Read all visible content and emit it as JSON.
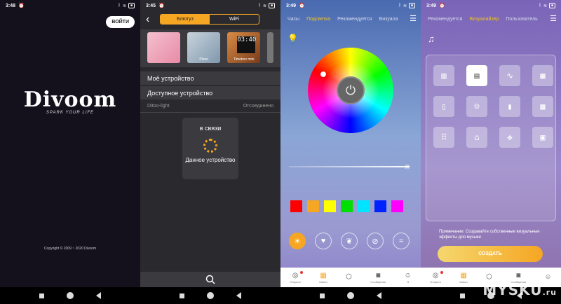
{
  "screen1": {
    "status_time": "3:48",
    "login_label": "ВОЙТИ",
    "logo_text": "Divoom",
    "logo_tagline": "SPARK YOUR LIFE",
    "copyright": "Copyright © 2009 ~ 2020 Divoom"
  },
  "screen2": {
    "status_time": "3:45",
    "tab_bluetooth": "Блютуз",
    "tab_wifi": "WiFi",
    "thumbs": [
      {
        "caption": ""
      },
      {
        "caption": "Pixoo"
      },
      {
        "caption": "Timebox mini"
      }
    ],
    "clock_text": "03:40",
    "my_device": "Моё устройство",
    "available_device": "Доступное устройство",
    "device_name": "Ditoo-light",
    "device_status": "Отсоединено",
    "modal_title": "в связи",
    "modal_text": "Данное устройство"
  },
  "screen3": {
    "status_time": "3:49",
    "tabs": [
      "Часы",
      "Подсветка",
      "Рекомендуется",
      "Визуала"
    ],
    "active_tab": "Подсветка",
    "swatch_colors": [
      "#ff0000",
      "#f5a623",
      "#ffff00",
      "#00e000",
      "#00e5ff",
      "#0022ff",
      "#ff00ff"
    ],
    "bottom_tabs": [
      {
        "label": "Открыть",
        "icon": "compass-icon"
      },
      {
        "label": "Канал",
        "icon": "grid-icon"
      },
      {
        "label": "",
        "icon": "cube-icon"
      },
      {
        "label": "Сообщения",
        "icon": "chat-icon"
      },
      {
        "label": "Я",
        "icon": "user-icon"
      }
    ]
  },
  "screen4": {
    "status_time": "3:49",
    "tabs": [
      "Рекомендуется",
      "Визуалайзер",
      "Пользователь"
    ],
    "active_tab": "Визуалайзер",
    "note": "Примечание: Создавайте собственные визуальные эффекты для музыки",
    "create_label": "СОЗДАТЬ",
    "bottom_tabs": [
      {
        "label": "Открыть",
        "icon": "compass-icon"
      },
      {
        "label": "Канал",
        "icon": "grid-icon"
      },
      {
        "label": "",
        "icon": "cube-icon"
      },
      {
        "label": "Сообщения",
        "icon": "chat-icon"
      },
      {
        "label": "",
        "icon": "user-icon"
      }
    ],
    "watermark": "MYSKU",
    "watermark_suffix": ".ru"
  }
}
